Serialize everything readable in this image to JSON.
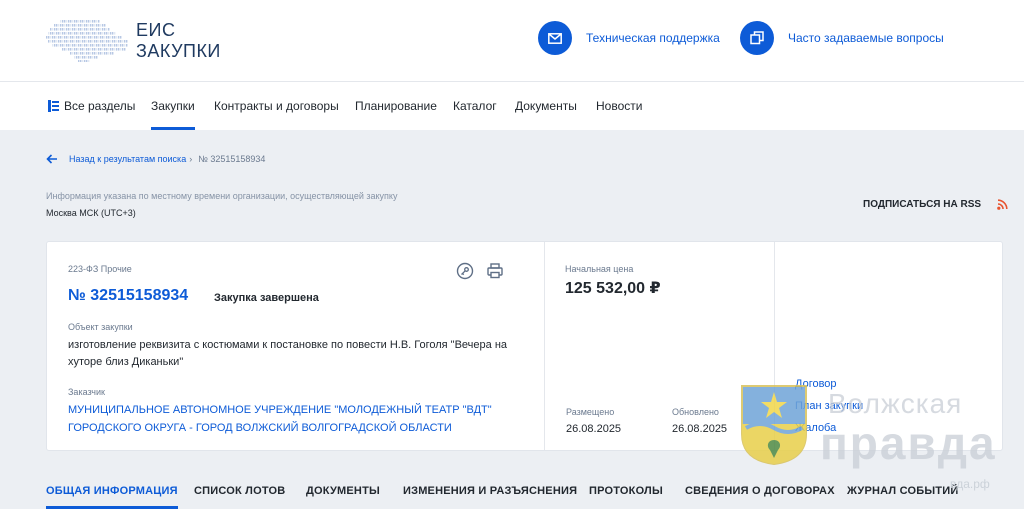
{
  "header": {
    "logo_line1": "ЕИС",
    "logo_line2": "ЗАКУПКИ",
    "support_label": "Техническая поддержка",
    "faq_label": "Часто задаваемые вопросы",
    "accent": "#0d5bd7"
  },
  "nav": {
    "items": [
      "Все разделы",
      "Закупки",
      "Контракты и договоры",
      "Планирование",
      "Каталог",
      "Документы",
      "Новости"
    ],
    "active": "Закупки"
  },
  "breadcrumb": {
    "back": "Назад к результатам поиска",
    "separator": "›",
    "current": "№ 32515158934"
  },
  "timezone": {
    "info": "Информация указана по местному времени организации, осуществляющей закупку",
    "value": "Москва МСК (UTC+3)"
  },
  "rss_label": "ПОДПИСАТЬСЯ НА RSS",
  "purchase": {
    "law": "223-ФЗ Прочие",
    "number": "№ 32515158934",
    "status": "Закупка завершена",
    "object_label": "Объект закупки",
    "object": "изготовление реквизита с костюмами к постановке по повести Н.В. Гоголя \"Вечера на хуторе близ Диканьки\"",
    "customer_label": "Заказчик",
    "customer": "МУНИЦИПАЛЬНОЕ АВТОНОМНОЕ УЧРЕЖДЕНИЕ \"МОЛОДЕЖНЫЙ ТЕАТР \"ВДТ\" ГОРОДСКОГО ОКРУГА - ГОРОД ВОЛЖСКИЙ ВОЛГОГРАДСКОЙ ОБЛАСТИ",
    "price_label": "Начальная цена",
    "price": "125 532,00 ₽",
    "posted_label": "Размещено",
    "posted": "26.08.2025",
    "updated_label": "Обновлено",
    "updated": "26.08.2025",
    "links": [
      "Договор",
      "План закупки",
      "Жалоба"
    ]
  },
  "tabs": [
    "ОБЩАЯ ИНФОРМАЦИЯ",
    "СПИСОК ЛОТОВ",
    "ДОКУМЕНТЫ",
    "ИЗМЕНЕНИЯ И РАЗЪЯСНЕНИЯ",
    "ПРОТОКОЛЫ",
    "СВЕДЕНИЯ О ДОГОВОРАХ",
    "ЖУРНАЛ СОБЫТИЙ"
  ],
  "watermark": {
    "line1": "Волжская",
    "line2": "правда",
    "line3": "вда.рф"
  }
}
